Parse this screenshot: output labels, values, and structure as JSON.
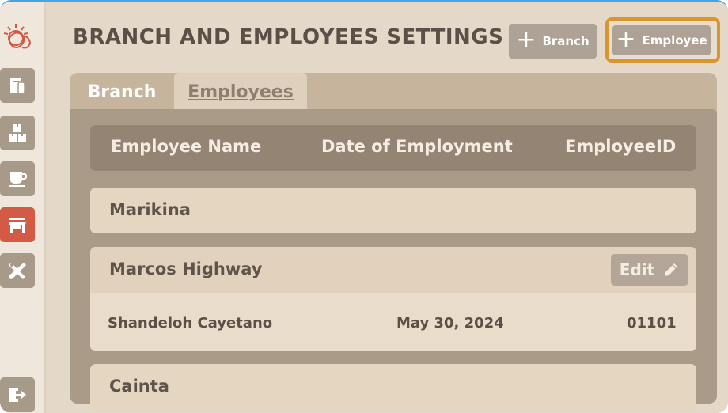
{
  "page": {
    "title": "BRANCH AND EMPLOYEES SETTINGS"
  },
  "actions": {
    "add_branch_label": "Branch",
    "add_employee_label": "Employee"
  },
  "tabs": [
    {
      "label": "Branch",
      "active": false
    },
    {
      "label": "Employees",
      "active": true
    }
  ],
  "table": {
    "headers": [
      "Employee Name",
      "Date of Employment",
      "EmployeeID"
    ]
  },
  "branches": [
    {
      "name": "Marikina",
      "employees": []
    },
    {
      "name": "Marcos Highway",
      "edit_label": "Edit",
      "employees": [
        {
          "name": "Shandeloh Cayetano",
          "date": "May 30, 2024",
          "id": "01101"
        }
      ]
    },
    {
      "name": "Cainta",
      "employees": []
    }
  ],
  "sidebar": {
    "items": [
      {
        "icon": "document-icon",
        "active": false
      },
      {
        "icon": "boxes-icon",
        "active": false
      },
      {
        "icon": "coffee-cup-icon",
        "active": false
      },
      {
        "icon": "store-icon",
        "active": true
      },
      {
        "icon": "tools-icon",
        "active": false
      }
    ],
    "logout_icon": "logout-icon"
  },
  "colors": {
    "accent_highlight": "#d8962e",
    "active_sidebar": "#d35a44",
    "sidebar_button": "#a89a88"
  }
}
